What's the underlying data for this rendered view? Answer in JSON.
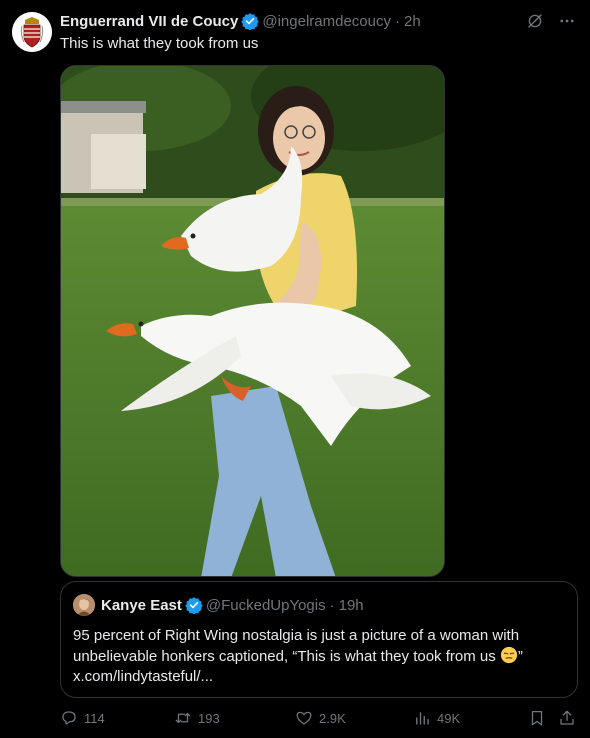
{
  "post": {
    "author_name": "Enguerrand VII de Coucy",
    "handle": "@ingelramdecoucy",
    "separator": "·",
    "time": "2h",
    "text": "This is what they took from us"
  },
  "quoted_post": {
    "author_name": "Kanye East",
    "handle": "@FuckedUpYogis",
    "separator": "·",
    "time": "19h",
    "text_line1": "95 percent of Right Wing nostalgia is just a picture of a woman with",
    "text_line2": "unbelievable honkers captioned, “This is what they took from us",
    "text_line2_end": "”",
    "link": "x.com/lindytasteful/..."
  },
  "actions": {
    "replies": "114",
    "reposts": "193",
    "likes": "2.9K",
    "views": "49K"
  },
  "icons": [
    "verified-badge-icon",
    "grok-icon",
    "more-icon",
    "reply-icon",
    "repost-icon",
    "like-icon",
    "views-icon",
    "bookmark-icon",
    "share-icon",
    "unamused-face-emoji"
  ],
  "colors": {
    "background": "#000000",
    "text": "#e7e9ea",
    "secondary_text": "#71767b",
    "verified": "#1d9bf0",
    "border": "#2f3336"
  }
}
